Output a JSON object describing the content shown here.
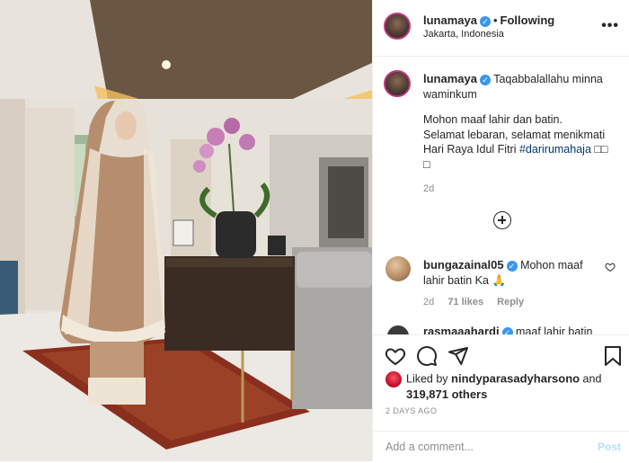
{
  "header": {
    "username": "lunamaya",
    "separator": "•",
    "follow_state": "Following",
    "location": "Jakarta, Indonesia",
    "more_glyph": "•••"
  },
  "caption": {
    "username": "lunamaya",
    "line1": "Taqabbalallahu minna waminkum",
    "line2": "Mohon maaf lahir dan batin.",
    "line3": "Selamat lebaran, selamat menikmati",
    "line4_prefix": "Hari Raya Idul Fitri ",
    "hashtag": "#darirumahaja",
    "emoji_tail": " □□",
    "emoji_line": "□",
    "age": "2d"
  },
  "load_more_icon": "plus-circle-icon",
  "comments": [
    {
      "username": "bungazainal05",
      "text": "Mohon maaf lahir batin Ka",
      "emoji": "🙏",
      "age": "2d",
      "likes": "71 likes",
      "reply": "Reply"
    },
    {
      "username": "rasmaaahardi",
      "text": "maaf lahir batin"
    }
  ],
  "actions": {
    "icons": [
      "heart-icon",
      "comment-icon",
      "share-icon",
      "bookmark-icon"
    ]
  },
  "likes": {
    "prefix": "Liked by ",
    "user": "nindyparasadyharsono",
    "connector": " and",
    "count_text": "319,871 others"
  },
  "post_date": "2 DAYS AGO",
  "add_comment": {
    "placeholder": "Add a comment...",
    "post_label": "Post"
  },
  "colors": {
    "verified": "#3897f0",
    "hashtag": "#00376b",
    "secondary": "#8e8e8e",
    "post_disabled": "#b2dffc"
  }
}
